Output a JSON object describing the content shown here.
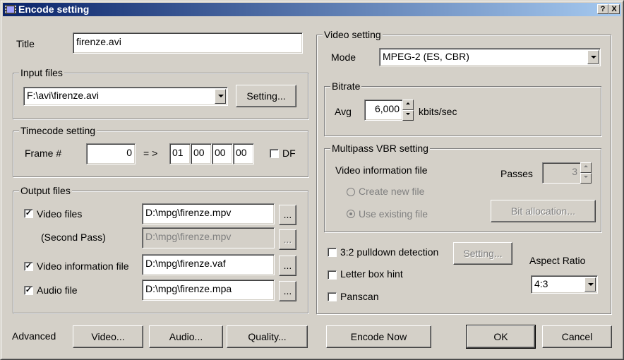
{
  "window": {
    "title": "Encode setting",
    "help_label": "?",
    "close_label": "X"
  },
  "title_field": {
    "label": "Title",
    "value": "firenze.avi"
  },
  "input_files": {
    "group_label": "Input files",
    "selected": "F:\\avi\\firenze.avi",
    "setting_button": "Setting..."
  },
  "timecode": {
    "group_label": "Timecode setting",
    "frame_label": "Frame #",
    "frame_value": "0",
    "arrow": "= >",
    "hh": "01",
    "mm": "00",
    "ss": "00",
    "ff": "00",
    "df_label": "DF",
    "df_checked": false
  },
  "output_files": {
    "group_label": "Output files",
    "video_label": "Video files",
    "video_checked": true,
    "video_value": "D:\\mpg\\firenze.mpv",
    "second_pass_label": "(Second Pass)",
    "second_pass_value": "D:\\mpg\\firenze.mpv",
    "vinfo_label": "Video information file",
    "vinfo_checked": true,
    "vinfo_value": "D:\\mpg\\firenze.vaf",
    "audio_label": "Audio file",
    "audio_checked": true,
    "audio_value": "D:\\mpg\\firenze.mpa",
    "browse_label": "..."
  },
  "video_setting": {
    "group_label": "Video setting",
    "mode_label": "Mode",
    "mode_value": "MPEG-2 (ES, CBR)",
    "bitrate": {
      "group_label": "Bitrate",
      "avg_label": "Avg",
      "avg_value": "6,000",
      "unit": "kbits/sec"
    },
    "multipass": {
      "group_label": "Multipass VBR setting",
      "vinfo_label": "Video information file",
      "passes_label": "Passes",
      "passes_value": "3",
      "create_new": "Create new file",
      "use_existing": "Use existing file",
      "bit_alloc": "Bit allocation..."
    },
    "pulldown_label": "3:2 pulldown detection",
    "pulldown_checked": false,
    "pulldown_setting": "Setting...",
    "letterbox_label": "Letter box hint",
    "letterbox_checked": false,
    "panscan_label": "Panscan",
    "panscan_checked": false,
    "aspect_label": "Aspect Ratio",
    "aspect_value": "4:3"
  },
  "footer": {
    "advanced_label": "Advanced",
    "video_btn": "Video...",
    "audio_btn": "Audio...",
    "quality_btn": "Quality...",
    "encode_btn": "Encode Now",
    "ok_btn": "OK",
    "cancel_btn": "Cancel"
  }
}
